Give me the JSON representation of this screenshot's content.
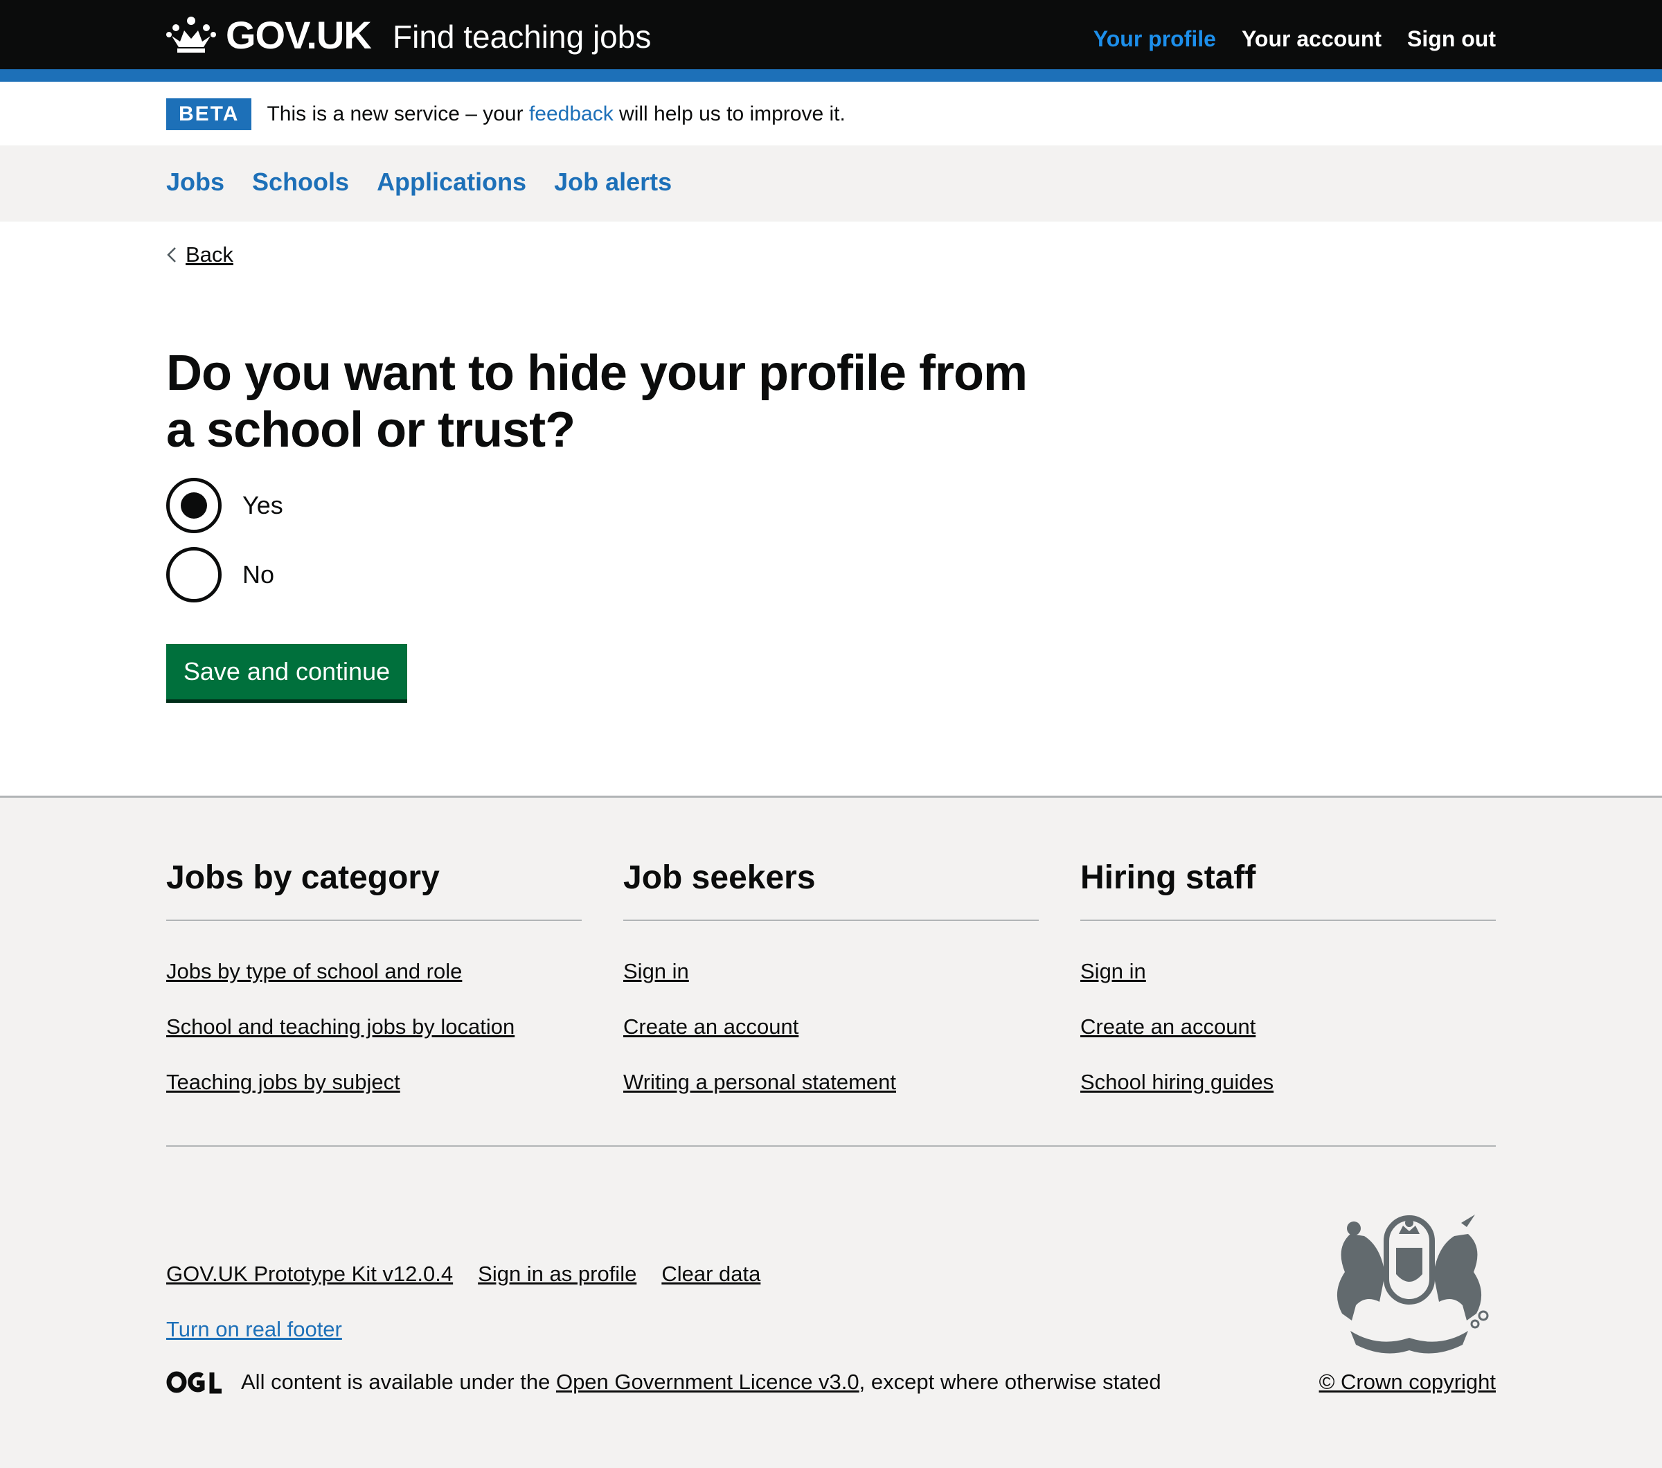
{
  "header": {
    "logo_text": "GOV.UK",
    "service_name": "Find teaching jobs",
    "nav": [
      {
        "label": "Your profile",
        "active": true
      },
      {
        "label": "Your account",
        "active": false
      },
      {
        "label": "Sign out",
        "active": false
      }
    ]
  },
  "phase_banner": {
    "tag": "BETA",
    "text_before": "This is a new service – your ",
    "link": "feedback",
    "text_after": " will help us to improve it."
  },
  "primary_nav": [
    "Jobs",
    "Schools",
    "Applications",
    "Job alerts"
  ],
  "back_link": "Back",
  "question": {
    "heading": "Do you want to hide your profile from a school or trust?",
    "options": [
      {
        "label": "Yes",
        "checked": true
      },
      {
        "label": "No",
        "checked": false
      }
    ]
  },
  "submit_label": "Save and continue",
  "footer": {
    "columns": [
      {
        "title": "Jobs by category",
        "links": [
          "Jobs by type of school and role",
          "School and teaching jobs by location",
          "Teaching jobs by subject"
        ]
      },
      {
        "title": "Job seekers",
        "links": [
          "Sign in",
          "Create an account",
          "Writing a personal statement"
        ]
      },
      {
        "title": "Hiring staff",
        "links": [
          "Sign in",
          "Create an account",
          "School hiring guides"
        ]
      }
    ],
    "meta_links": [
      "GOV.UK Prototype Kit v12.0.4",
      "Sign in as profile",
      "Clear data"
    ],
    "real_footer_link": "Turn on real footer",
    "licence_before": "All content is available under the ",
    "licence_link": "Open Government Licence v3.0",
    "licence_after": ", except where otherwise stated",
    "copyright": "© Crown copyright"
  },
  "colors": {
    "header_bg": "#0b0c0c",
    "brand_blue": "#1d70b8",
    "active_nav": "#1d8feb",
    "button_green": "#00703c",
    "footer_bg": "#f3f2f1"
  }
}
